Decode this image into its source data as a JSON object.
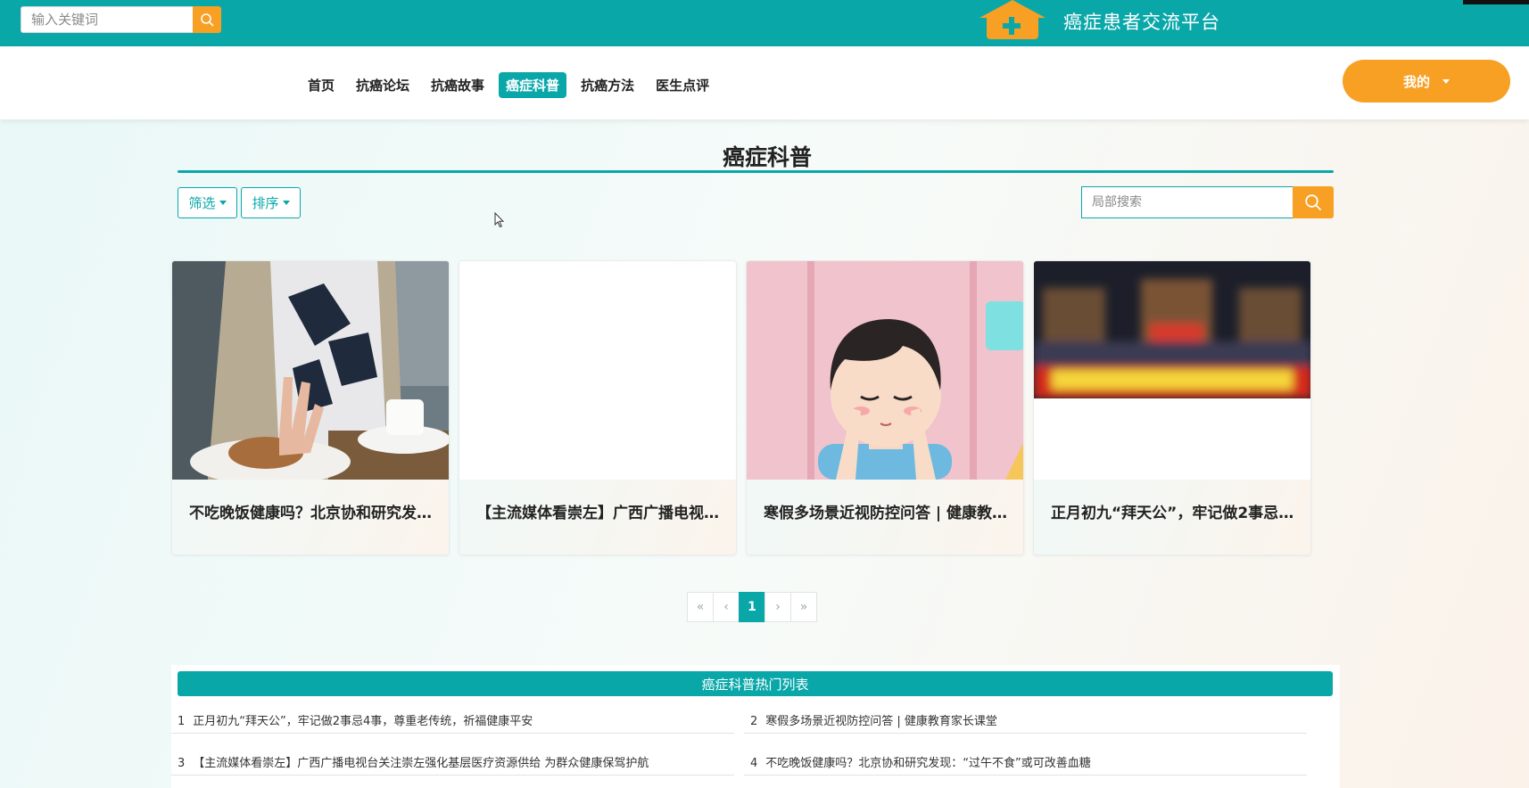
{
  "header": {
    "search_placeholder": "输入关键词",
    "site_title": "癌症患者交流平台",
    "search_icon": "search-icon",
    "logo_icon": "house-plus-icon"
  },
  "nav": {
    "items": [
      {
        "label": "首页",
        "active": false
      },
      {
        "label": "抗癌论坛",
        "active": false
      },
      {
        "label": "抗癌故事",
        "active": false
      },
      {
        "label": "癌症科普",
        "active": true
      },
      {
        "label": "抗癌方法",
        "active": false
      },
      {
        "label": "医生点评",
        "active": false
      }
    ],
    "mine_label": "我的"
  },
  "page": {
    "title": "癌症科普",
    "filter_label": "筛选",
    "sort_label": "排序",
    "local_search_placeholder": "局部搜索"
  },
  "cards": [
    {
      "title": "不吃晚饭健康吗？北京协和研究发现：“过午不食”或可改善血糖",
      "image": "photo-hand-refusing-bread"
    },
    {
      "title": "【主流媒体看崇左】广西广播电视台关注崇左强化基层医疗资源供给 为群众健康保驾护航",
      "image": "blank"
    },
    {
      "title": "寒假多场景近视防控问答 | 健康教育家长课堂",
      "image": "cartoon-boy-eye-exercise"
    },
    {
      "title": "正月初九“拜天公”，牢记做2事忌4事，尊重老传统，祈福健康平安",
      "image": "blurred-festival-night"
    }
  ],
  "pagination": {
    "first": "«",
    "prev": "‹",
    "current": "1",
    "next": "›",
    "last": "»"
  },
  "hot_list": {
    "title": "癌症科普热门列表",
    "items": [
      {
        "num": "1",
        "text": "正月初九“拜天公”，牢记做2事忌4事，尊重老传统，祈福健康平安"
      },
      {
        "num": "2",
        "text": "寒假多场景近视防控问答 | 健康教育家长课堂"
      },
      {
        "num": "3",
        "text": "【主流媒体看崇左】广西广播电视台关注崇左强化基层医疗资源供给 为群众健康保驾护航"
      },
      {
        "num": "4",
        "text": "不吃晚饭健康吗？北京协和研究发现：“过午不食”或可改善血糖"
      }
    ]
  },
  "colors": {
    "primary": "#0aa7a9",
    "accent": "#f7a024"
  }
}
